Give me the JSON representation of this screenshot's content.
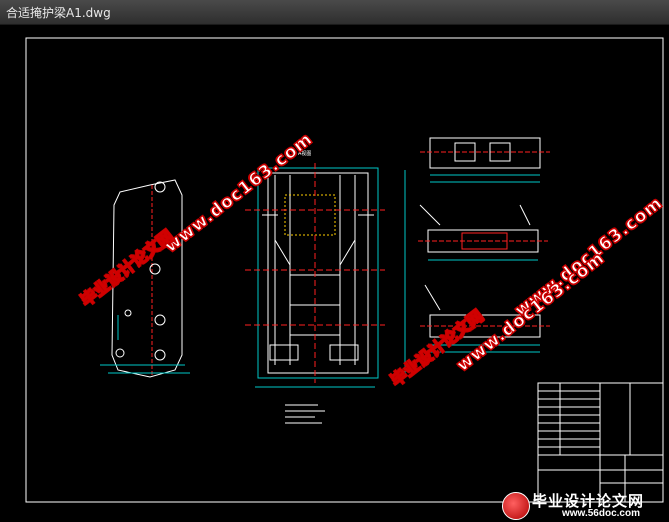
{
  "window": {
    "title": "合适掩护梁A1.dwg"
  },
  "drawing": {
    "title_label": "A视图"
  },
  "watermarks": {
    "site": "www.doc163.com",
    "cn": "毕业设计论文网"
  },
  "brand": {
    "cn": "毕业设计论文网",
    "site": "www.56doc.com"
  },
  "colors": {
    "background": "#000000",
    "titlebar": "#3a3a3a",
    "linework": "#ffffff",
    "centerline": "#ff2020",
    "dims": "#00c8c8",
    "watermark_stroke": "#d00000"
  }
}
